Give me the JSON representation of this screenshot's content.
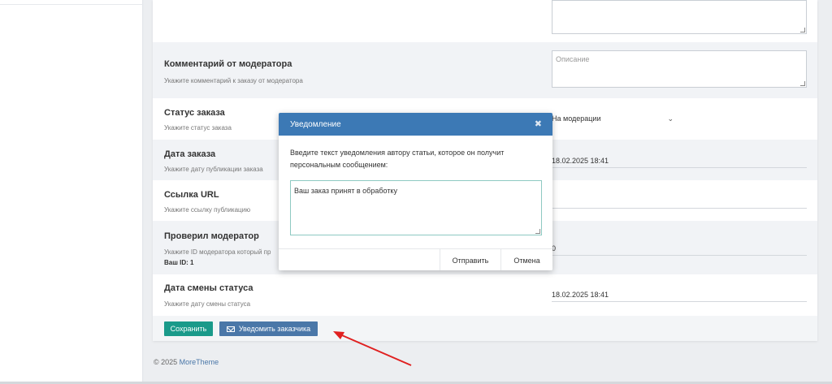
{
  "form": {
    "moderator_comment": {
      "label": "Комментарий от модератора",
      "help": "Укажите комментарий к заказу от модератора",
      "placeholder": "Описание"
    },
    "order_status": {
      "label": "Статус заказа",
      "help": "Укажите статус заказа",
      "value": "На модерации"
    },
    "order_date": {
      "label": "Дата заказа",
      "help": "Укажите дату публикации заказа",
      "value": "18.02.2025 18:41"
    },
    "url": {
      "label": "Ссылка URL",
      "help": "Укажите ссылку публикацию"
    },
    "checked_by": {
      "label": "Проверил модератор",
      "help": "Укажите ID модератора который пр",
      "your_id": "Ваш ID: 1",
      "value": "0"
    },
    "status_change_date": {
      "label": "Дата смены статуса",
      "help": "Укажите дату смены статуса",
      "value": "18.02.2025 18:41"
    }
  },
  "buttons": {
    "save": "Сохранить",
    "notify": "Уведомить заказчика"
  },
  "footer": {
    "copyright": "© 2025 ",
    "brand": "MoreTheme"
  },
  "modal": {
    "title": "Уведомление",
    "close": "✖",
    "text": "Введите текст уведомления автору статьи, которое он получит персональным сообщением:",
    "textarea_value": "Ваш заказ принят в обработку",
    "send": "Отправить",
    "cancel": "Отмена"
  },
  "colors": {
    "accent_teal": "#1a9a8a",
    "accent_blue": "#4a77a8",
    "modal_header": "#3c79b5",
    "arrow": "#e02020"
  },
  "icons": {
    "close": "close-icon",
    "envelope": "envelope-icon",
    "select_chevron": "chevron-down-icon"
  }
}
